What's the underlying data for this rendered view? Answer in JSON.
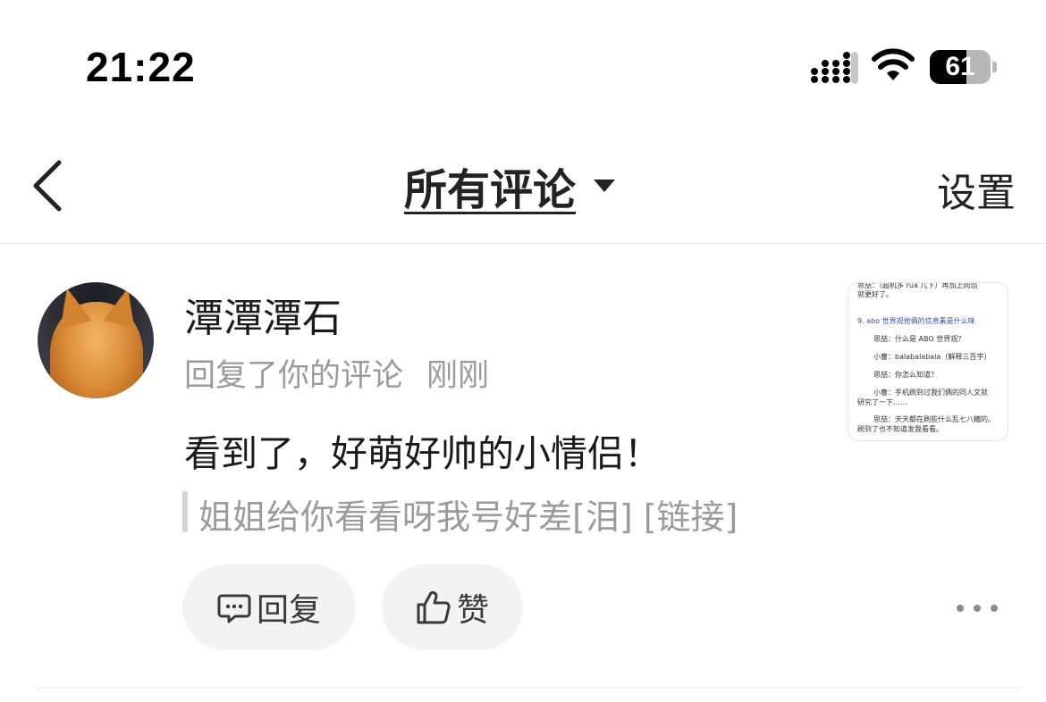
{
  "status_bar": {
    "time": "21:22",
    "battery_level": "61",
    "battery_fraction": 0.61
  },
  "nav": {
    "title": "所有评论",
    "settings_label": "设置"
  },
  "comment": {
    "username": "潭潭潭石",
    "action": "回复了你的评论",
    "time": "刚刚",
    "text": "看到了，好萌好帅的小情侣！",
    "quoted": "姐姐给你看看呀我号好差[泪] [链接]",
    "thumbnail_lines": [
      "思喆：（超机多 rua 几下）再加上肉馅",
      "就更好了。",
      "9. abo 世界观他俩的信息素是什么味",
      "思喆：什么是 ABO 世界观？",
      "小曹：balabalabala（解释三百字）",
      "思喆：你怎么知道？",
      "小曹：手机刷到过我们俩的同人文就",
      "研究了一下……",
      "思喆：天天都在刷些什么乱七八糟的。",
      "刷到了也不知道发我看看。"
    ]
  },
  "actions": {
    "reply_label": "回复",
    "like_label": "赞"
  },
  "icons": {
    "back": "chevron-left-icon",
    "dropdown": "caret-down-icon",
    "reply": "comment-bubble-icon",
    "like": "thumbs-up-icon",
    "more": "ellipsis-icon"
  },
  "colors": {
    "primary_text": "#1a1a1a",
    "secondary_text": "#9b9b9b",
    "pill_bg": "#f3f3f3",
    "thumbnail_heading": "#3a4bb3"
  }
}
